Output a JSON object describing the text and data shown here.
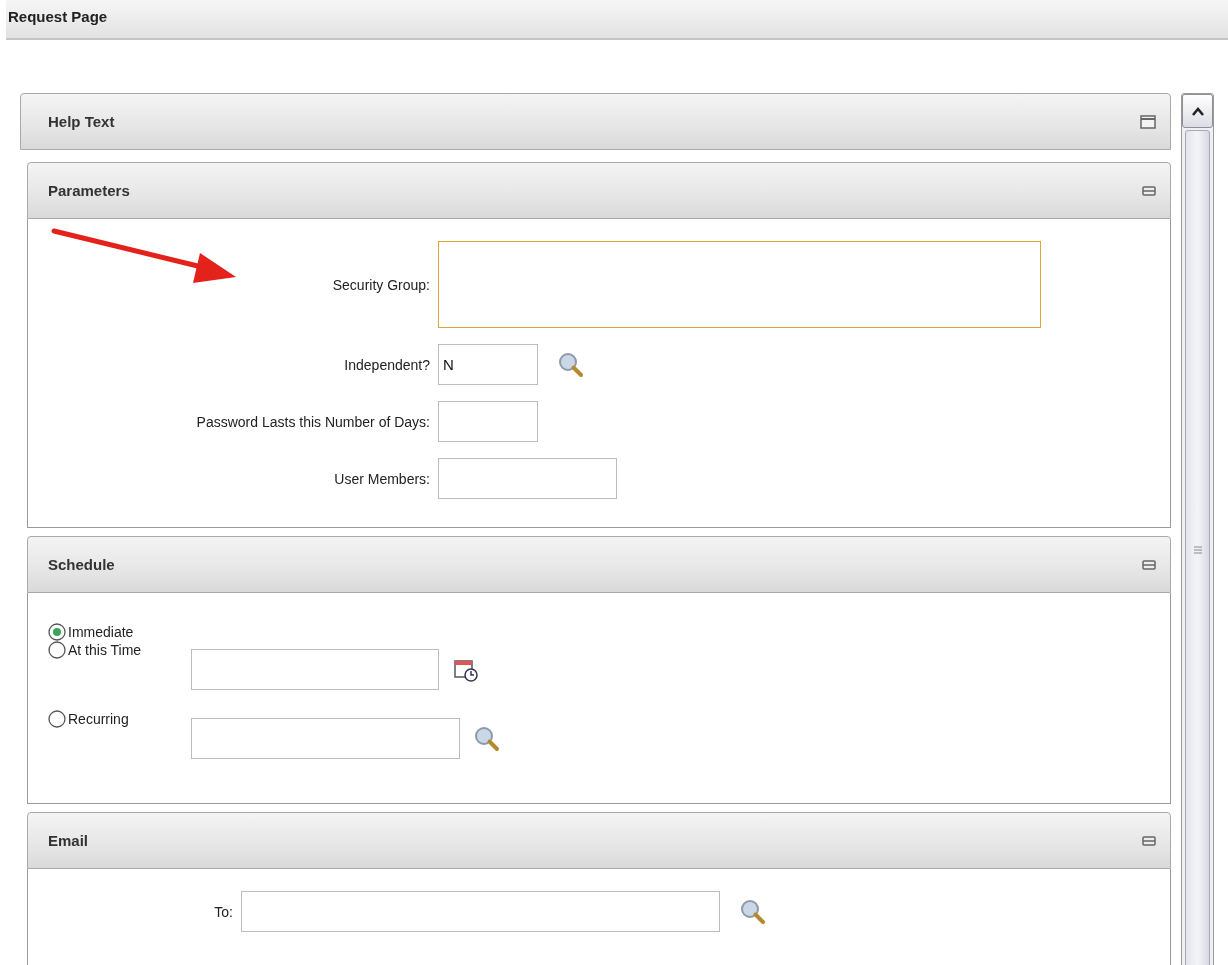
{
  "page_title": "Request Page",
  "help_panel": {
    "title": "Help Text",
    "expanded": false
  },
  "parameters": {
    "title": "Parameters",
    "expanded": true,
    "fields": [
      {
        "label": "Security Group:",
        "focused": true,
        "kind": "multiline",
        "lookup": false
      },
      {
        "label": "Independent?",
        "value": "N",
        "focused": false,
        "kind": "short",
        "lookup": true
      },
      {
        "label": "Password Lasts this Number of Days:",
        "focused": false,
        "kind": "short",
        "lookup": false
      },
      {
        "label": "User Members:",
        "focused": false,
        "kind": "medium",
        "lookup": false
      }
    ]
  },
  "schedule": {
    "title": "Schedule",
    "expanded": true,
    "options": [
      {
        "label": "Immediate",
        "selected": true,
        "kind": "plain"
      },
      {
        "label": "At this Time",
        "selected": false,
        "kind": "datetime"
      },
      {
        "label": "Recurring",
        "selected": false,
        "kind": "lookup"
      }
    ]
  },
  "email": {
    "title": "Email",
    "expanded": true,
    "fields": [
      {
        "label": "To:",
        "lookup": true
      }
    ]
  }
}
